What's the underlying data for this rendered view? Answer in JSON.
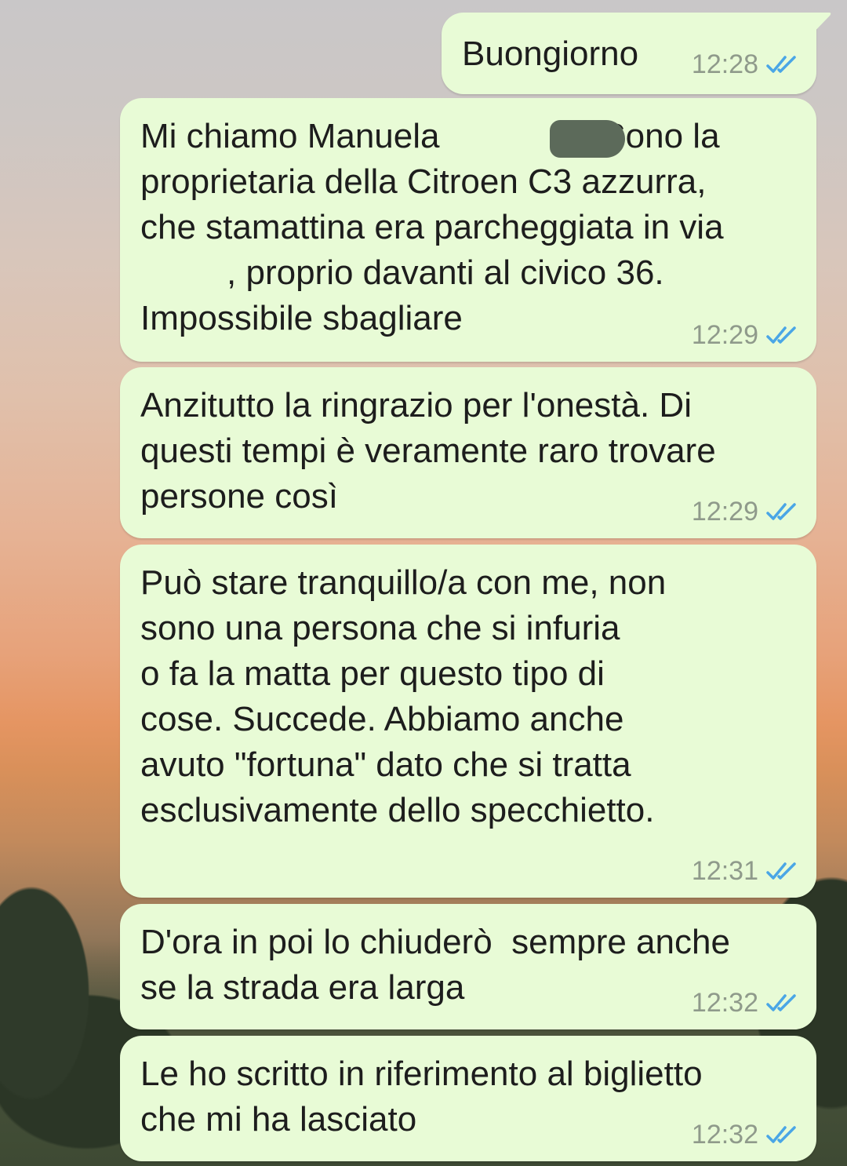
{
  "colors": {
    "outgoing_bubble": "#e8fbd6",
    "read_ticks": "#4aa6e6",
    "timestamp": "#8f9a8b",
    "redaction": "#5c6a5a"
  },
  "icons": {
    "read_receipt": "double-check-icon"
  },
  "messages": [
    {
      "text": "Buongiorno",
      "time": "12:28",
      "status": "read"
    },
    {
      "text": "Mi chiamo Manuela                 Sono la\nproprietaria della Citroen C3 azzurra,\nche stamattina era parcheggiata in via\n         , proprio davanti al civico 36.\nImpossibile sbagliare",
      "time": "12:29",
      "status": "read"
    },
    {
      "text": "Anzitutto la ringrazio per l'onestà. Di\nquesti tempi è veramente raro trovare\npersone così",
      "time": "12:29",
      "status": "read"
    },
    {
      "text": "Può stare tranquillo/a con me, non\nsono una persona che si infuria\no fa la matta per questo tipo di\ncose. Succede. Abbiamo anche\navuto \"fortuna\" dato che si tratta\nesclusivamente dello specchietto.",
      "time": "12:31",
      "status": "read"
    },
    {
      "text": "D'ora in poi lo chiuderò  sempre anche\nse la strada era larga",
      "time": "12:32",
      "status": "read"
    },
    {
      "text": "Le ho scritto in riferimento al biglietto\nche mi ha lasciato",
      "time": "12:32",
      "status": "read"
    }
  ]
}
